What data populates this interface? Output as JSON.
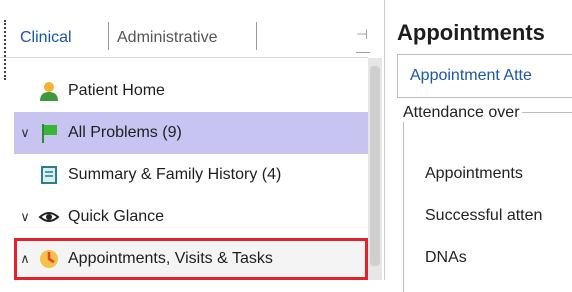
{
  "tabs": {
    "clinical": "Clinical",
    "administrative": "Administrative"
  },
  "nav": {
    "items": [
      {
        "label": "Patient Home",
        "icon": "person-icon",
        "chevron": ""
      },
      {
        "label": "All Problems (9)",
        "icon": "flag-icon",
        "chevron": "expanded"
      },
      {
        "label": "Summary & Family History (4)",
        "icon": "scroll-icon",
        "chevron": ""
      },
      {
        "label": "Quick Glance",
        "icon": "eye-icon",
        "chevron": "expanded"
      },
      {
        "label": "Appointments, Visits & Tasks",
        "icon": "clock-icon",
        "chevron": "collapsed"
      }
    ]
  },
  "right": {
    "title": "Appointments",
    "tab": "Appointment Atte",
    "group_title": "Attendance over",
    "rows": [
      "Appointments",
      "Successful atten",
      "DNAs"
    ]
  },
  "colors": {
    "accent": "#1a56a6",
    "selected_bg": "#c7c4f2",
    "highlight_border": "#e0222a"
  }
}
